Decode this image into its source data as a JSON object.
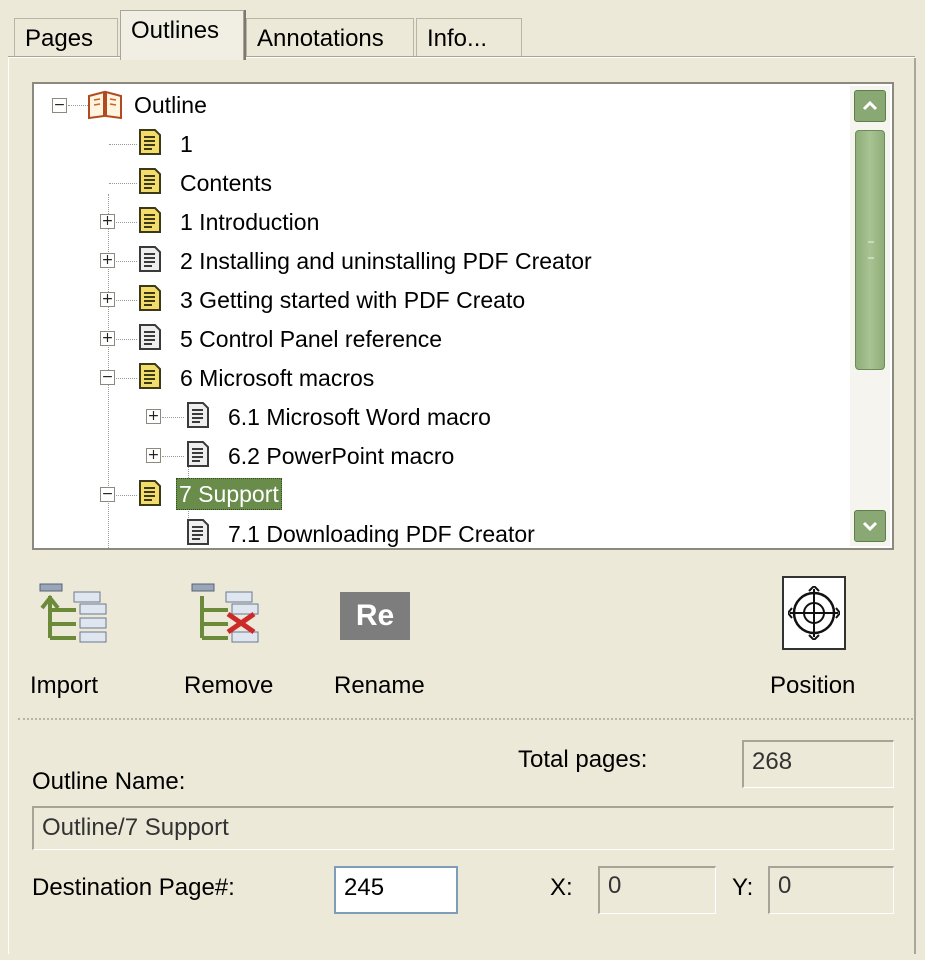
{
  "tabs": [
    {
      "label": "Pages"
    },
    {
      "label": "Outlines",
      "active": true
    },
    {
      "label": "Annotations"
    },
    {
      "label": "Info..."
    }
  ],
  "tree": {
    "root": "Outline",
    "items": [
      {
        "label": "1",
        "expander": "none",
        "icon": "page-yellow"
      },
      {
        "label": "Contents",
        "expander": "none",
        "icon": "page-yellow"
      },
      {
        "label": "1 Introduction",
        "expander": "+",
        "icon": "page-yellow"
      },
      {
        "label": "2 Installing and uninstalling PDF Creator",
        "expander": "+",
        "icon": "page-white"
      },
      {
        "label": "3 Getting started with PDF Creato",
        "expander": "+",
        "icon": "page-yellow"
      },
      {
        "label": "5 Control Panel reference",
        "expander": "+",
        "icon": "page-white"
      },
      {
        "label": "6 Microsoft macros",
        "expander": "-",
        "icon": "page-yellow"
      },
      {
        "label": "6.1 Microsoft Word macro",
        "expander": "+",
        "icon": "page-white"
      },
      {
        "label": "6.2 PowerPoint macro",
        "expander": "+",
        "icon": "page-white"
      },
      {
        "label": "7 Support",
        "expander": "-",
        "icon": "page-yellow",
        "selected": true
      },
      {
        "label": "7.1 Downloading PDF Creator",
        "expander": "none",
        "icon": "page-white"
      }
    ]
  },
  "toolbar": {
    "import_label": "Import",
    "remove_label": "Remove",
    "rename_label": "Rename",
    "rename_glyph": "Re",
    "position_label": "Position"
  },
  "form": {
    "total_pages_label": "Total pages:",
    "total_pages_value": "268",
    "outline_name_label": "Outline Name:",
    "outline_name_value": "Outline/7 Support",
    "destination_label": "Destination Page#:",
    "destination_value": "245",
    "x_label": "X:",
    "x_value": "0",
    "y_label": "Y:",
    "y_value": "0"
  },
  "colors": {
    "selection": "#6a8c4a",
    "scrollbar": "#8aa874",
    "panel_bg": "#ece9d8"
  }
}
